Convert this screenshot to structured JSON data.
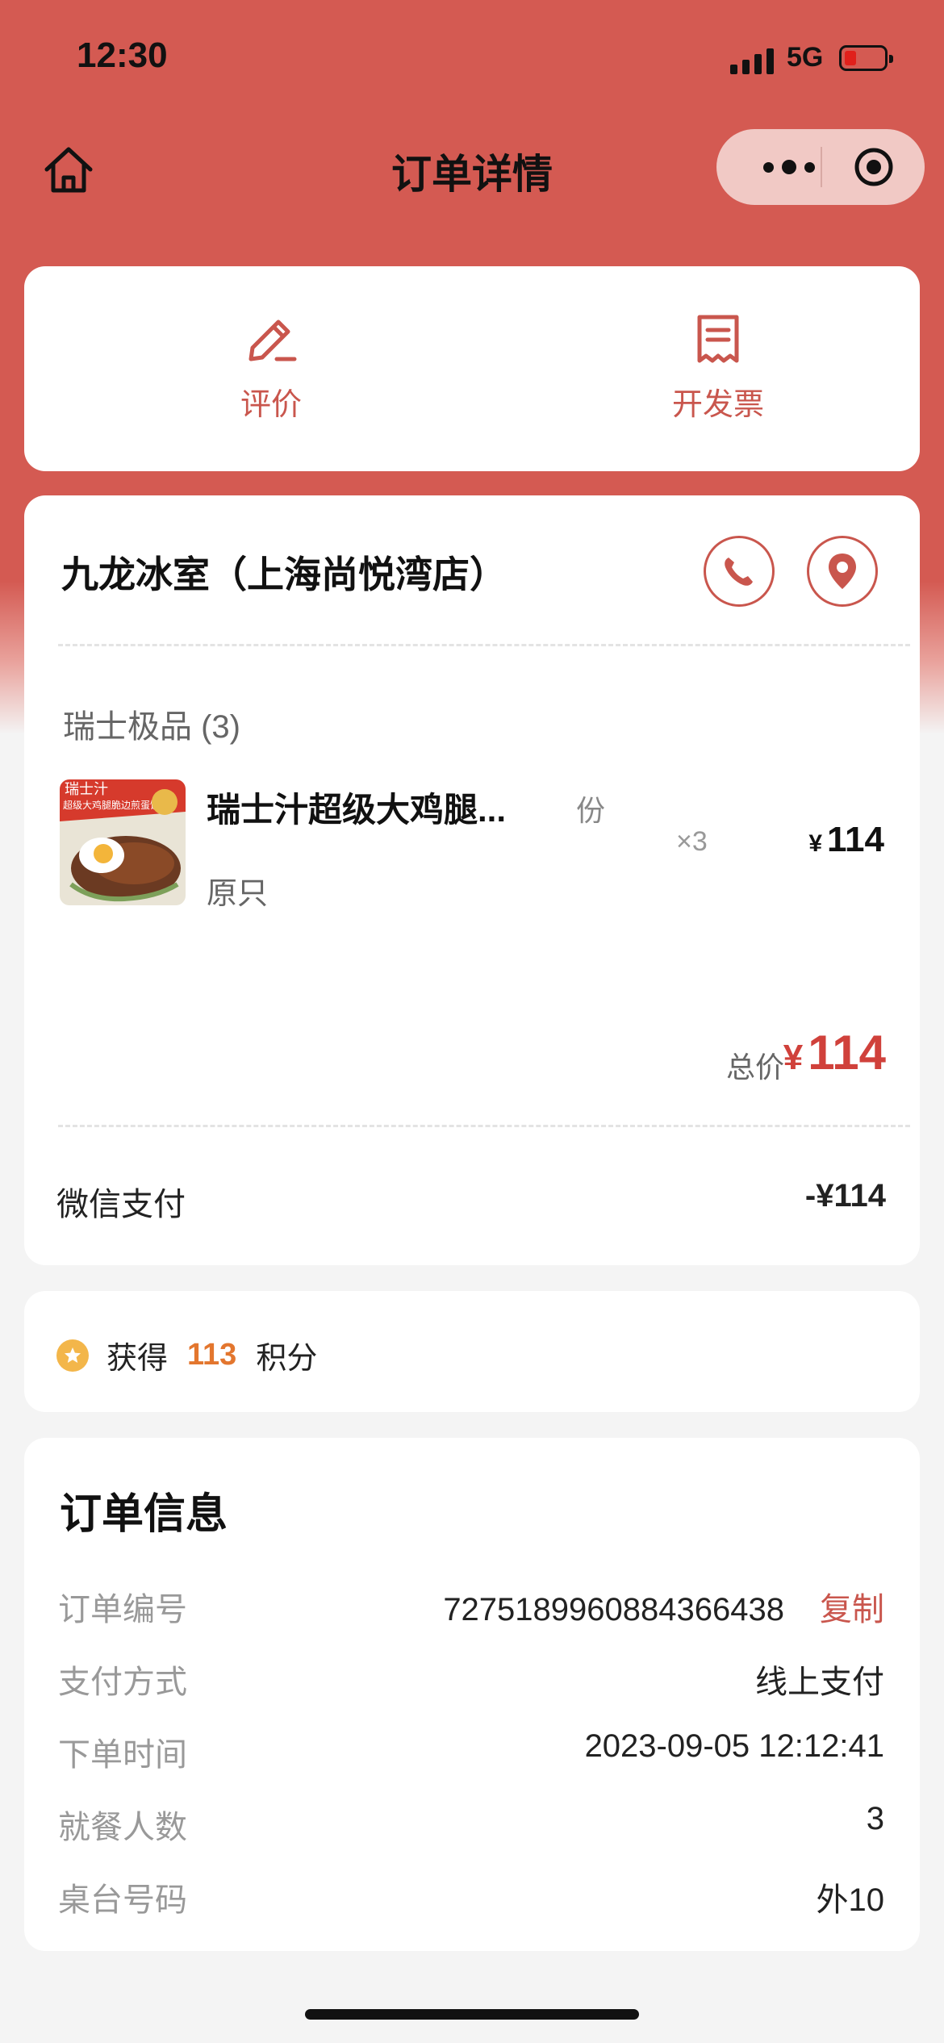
{
  "status_bar": {
    "time": "12:30",
    "network": "5G",
    "battery_icon": "battery-low-icon",
    "signal_icon": "signal-icon"
  },
  "nav": {
    "title": "订单详情",
    "home_icon": "home-icon",
    "more_icon": "more-dots-icon",
    "close_icon": "target-icon"
  },
  "actions": [
    {
      "label": "评价",
      "icon": "pencil-icon"
    },
    {
      "label": "开发票",
      "icon": "receipt-icon"
    }
  ],
  "order": {
    "store_name": "九龙冰室（上海尚悦湾店）",
    "category": "瑞士极品 (3)",
    "item": {
      "name": "瑞士汁超级大鸡腿...",
      "unit": "份",
      "spec": "原只",
      "qty": "×3",
      "currency": "¥",
      "price": "114",
      "thumb_text_1": "瑞士汁",
      "thumb_text_2": "超级大鸡腿脆边煎蛋饭"
    },
    "total_label": "总价",
    "total_currency": "¥",
    "total_value": "114",
    "payment_label": "微信支付",
    "payment_value": "-¥114"
  },
  "points": {
    "prefix": "获得",
    "value": "113",
    "suffix": "积分"
  },
  "info": {
    "title": "订单信息",
    "rows": [
      {
        "label": "订单编号",
        "value": "7275189960884366438",
        "action": "复制"
      },
      {
        "label": "支付方式",
        "value": "线上支付"
      },
      {
        "label": "下单时间",
        "value": "2023-09-05 12:12:41"
      },
      {
        "label": "就餐人数",
        "value": "3"
      },
      {
        "label": "桌台号码",
        "value": "外10"
      }
    ]
  },
  "colors": {
    "brand": "#d45a52",
    "accent": "#c9564d",
    "price": "#d0413b",
    "points": "#e3762e",
    "star": "#f3b64a"
  }
}
